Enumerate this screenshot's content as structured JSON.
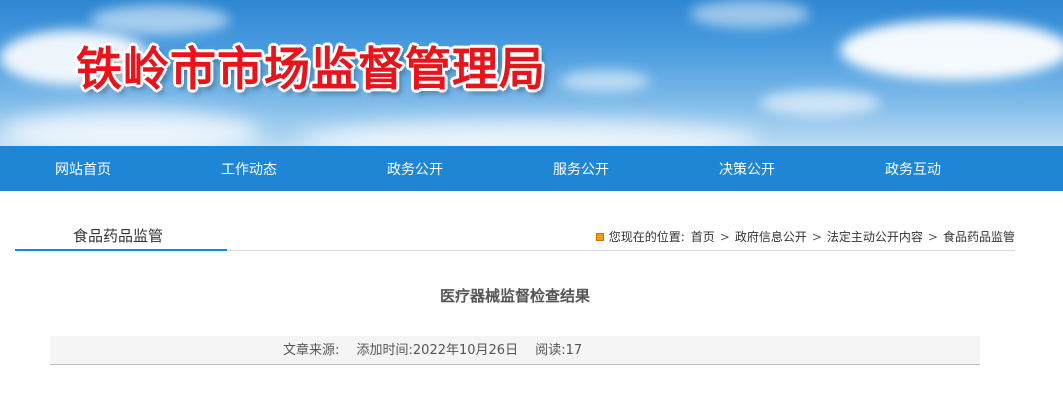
{
  "header": {
    "site_title": "铁岭市市场监督管理局"
  },
  "nav": {
    "items": [
      {
        "label": "网站首页"
      },
      {
        "label": "工作动态"
      },
      {
        "label": "政务公开"
      },
      {
        "label": "服务公开"
      },
      {
        "label": "决策公开"
      },
      {
        "label": "政务互动"
      }
    ]
  },
  "section": {
    "tab_label": "食品药品监管",
    "breadcrumb": {
      "prefix": "您现在的位置:",
      "separator": ">",
      "items": [
        "首页",
        "政府信息公开",
        "法定主动公开内容",
        "食品药品监管"
      ]
    }
  },
  "article": {
    "title": "医疗器械监督检查结果",
    "source_label": "文章来源:",
    "added_time": "添加时间:2022年10月26日",
    "reads": "阅读:17"
  },
  "colors": {
    "nav_bg": "#1f86d6",
    "title_red": "#e8141c",
    "breadcrumb_icon": "#f29b1b"
  }
}
